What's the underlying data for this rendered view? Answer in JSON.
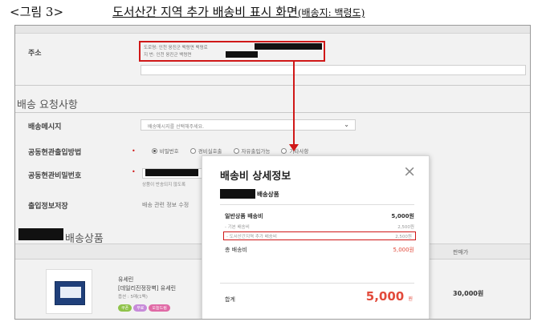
{
  "caption": {
    "number": "<그림 3>",
    "title": "도서산간 지역 추가 배송비 표시 화면",
    "subtitle": "(배송지: 백령도)"
  },
  "form": {
    "address_label": "주소",
    "address_line1": "도로명: 인천 옹진군 백령면 백령로",
    "address_line2": "지   번: 인천 옹진군 백령면",
    "section_request": "배송 요청사항",
    "message_label": "배송메시지",
    "message_placeholder": "배송메시지를 선택해주세요.",
    "entrance_label": "공동현관출입방법",
    "entrance_options": [
      "비밀번호",
      "경비실호출",
      "자유출입가능",
      "기타사항"
    ],
    "entrance_pw_label": "공동현관비밀번호",
    "entrance_hint": "상품이 반송되지 않도록",
    "save_label": "출입정보저장",
    "save_text": "배송 관련 정보 수정",
    "section_products": "배송상품"
  },
  "table": {
    "sale_price_header": "판매가"
  },
  "product": {
    "brand": "유세린",
    "name": "[데일리진정장벽] 유세린",
    "option": "옵션 : 5매(1팩)",
    "tags": [
      "쿠폰",
      "무료",
      "오늘드림"
    ],
    "price": "30,000원"
  },
  "modal": {
    "title": "배송비 상세정보",
    "close_icon": "×",
    "section": "배송상품",
    "general_label": "일반상품 배송비",
    "general_value": "5,000원",
    "base_label": "- 기본 배송비",
    "base_value": "2,500원",
    "remote_label": "- 도서산간지역 추가 배송비",
    "remote_value": "2,500원",
    "total_ship_label": "총 배송비",
    "total_ship_value": "5,000원",
    "sum_label": "합계",
    "sum_value": "5,000",
    "sum_unit": "원"
  },
  "colors": {
    "highlight": "#d01818",
    "price_accent": "#e24a3b"
  }
}
